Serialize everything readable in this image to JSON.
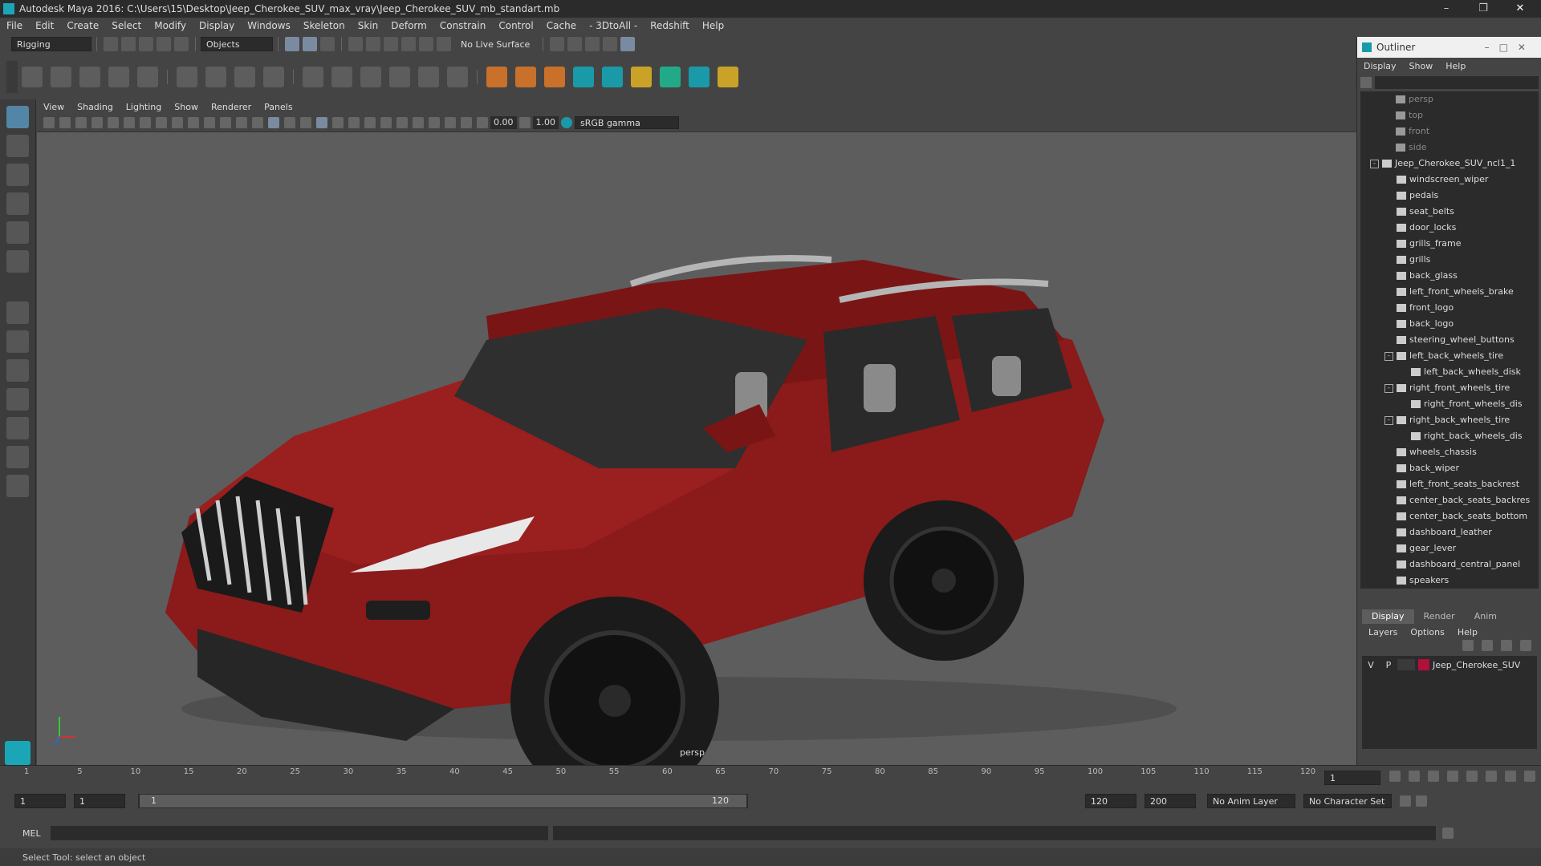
{
  "app": {
    "title": "Autodesk Maya 2016: C:\\Users\\15\\Desktop\\Jeep_Cherokee_SUV_max_vray\\Jeep_Cherokee_SUV_mb_standart.mb"
  },
  "menus": [
    "File",
    "Edit",
    "Create",
    "Select",
    "Modify",
    "Display",
    "Windows",
    "Skeleton",
    "Skin",
    "Deform",
    "Constrain",
    "Control",
    "Cache",
    "- 3DtoAll -",
    "Redshift",
    "Help"
  ],
  "statusline": {
    "menuset": "Rigging",
    "selmode": "Objects",
    "live_surface": "No Live Surface"
  },
  "viewport": {
    "menus": [
      "View",
      "Shading",
      "Lighting",
      "Show",
      "Renderer",
      "Panels"
    ],
    "exposure": "0.00",
    "gamma": "1.00",
    "colorspace": "sRGB gamma",
    "camera_label": "persp"
  },
  "outliner": {
    "title": "Outliner",
    "menus": [
      "Display",
      "Show",
      "Help"
    ],
    "items": [
      {
        "label": "persp",
        "kind": "cam",
        "depth": 0
      },
      {
        "label": "top",
        "kind": "cam",
        "depth": 0
      },
      {
        "label": "front",
        "kind": "cam",
        "depth": 0
      },
      {
        "label": "side",
        "kind": "cam",
        "depth": 0
      },
      {
        "label": "Jeep_Cherokee_SUV_ncl1_1",
        "kind": "grp",
        "depth": 0,
        "exp": "-"
      },
      {
        "label": "windscreen_wiper",
        "kind": "mesh",
        "depth": 1
      },
      {
        "label": "pedals",
        "kind": "mesh",
        "depth": 1
      },
      {
        "label": "seat_belts",
        "kind": "mesh",
        "depth": 1
      },
      {
        "label": "door_locks",
        "kind": "mesh",
        "depth": 1
      },
      {
        "label": "grills_frame",
        "kind": "mesh",
        "depth": 1
      },
      {
        "label": "grills",
        "kind": "mesh",
        "depth": 1
      },
      {
        "label": "back_glass",
        "kind": "mesh",
        "depth": 1
      },
      {
        "label": "left_front_wheels_brake",
        "kind": "mesh",
        "depth": 1
      },
      {
        "label": "front_logo",
        "kind": "mesh",
        "depth": 1
      },
      {
        "label": "back_logo",
        "kind": "mesh",
        "depth": 1
      },
      {
        "label": "steering_wheel_buttons",
        "kind": "mesh",
        "depth": 1
      },
      {
        "label": "left_back_wheels_tire",
        "kind": "mesh",
        "depth": 1,
        "exp": "-"
      },
      {
        "label": "left_back_wheels_disk",
        "kind": "mesh",
        "depth": 2
      },
      {
        "label": "right_front_wheels_tire",
        "kind": "mesh",
        "depth": 1,
        "exp": "-"
      },
      {
        "label": "right_front_wheels_dis",
        "kind": "mesh",
        "depth": 2
      },
      {
        "label": "right_back_wheels_tire",
        "kind": "mesh",
        "depth": 1,
        "exp": "-"
      },
      {
        "label": "right_back_wheels_dis",
        "kind": "mesh",
        "depth": 2
      },
      {
        "label": "wheels_chassis",
        "kind": "mesh",
        "depth": 1
      },
      {
        "label": "back_wiper",
        "kind": "mesh",
        "depth": 1
      },
      {
        "label": "left_front_seats_backrest",
        "kind": "mesh",
        "depth": 1
      },
      {
        "label": "center_back_seats_backres",
        "kind": "mesh",
        "depth": 1
      },
      {
        "label": "center_back_seats_bottom",
        "kind": "mesh",
        "depth": 1
      },
      {
        "label": "dashboard_leather",
        "kind": "mesh",
        "depth": 1
      },
      {
        "label": "gear_lever",
        "kind": "mesh",
        "depth": 1
      },
      {
        "label": "dashboard_central_panel",
        "kind": "mesh",
        "depth": 1
      },
      {
        "label": "speakers",
        "kind": "mesh",
        "depth": 1
      }
    ]
  },
  "layers": {
    "tabs": [
      "Display",
      "Render",
      "Anim"
    ],
    "menus": [
      "Layers",
      "Options",
      "Help"
    ],
    "layer": {
      "v": "V",
      "p": "P",
      "name": "Jeep_Cherokee_SUV",
      "color": "#b0103a"
    }
  },
  "timeline": {
    "ticks": [
      "1",
      "5",
      "10",
      "15",
      "20",
      "25",
      "30",
      "35",
      "40",
      "45",
      "50",
      "55",
      "60",
      "65",
      "70",
      "75",
      "80",
      "85",
      "90",
      "95",
      "100",
      "105",
      "110",
      "115",
      "120"
    ],
    "current": "1"
  },
  "range": {
    "start": "1",
    "inner_start": "1",
    "slider_start": "1",
    "slider_end": "120",
    "end": "120",
    "max": "200",
    "anim_layer": "No Anim Layer",
    "char_set": "No Character Set"
  },
  "cmd": {
    "label": "MEL"
  },
  "help": {
    "text": "Select Tool: select an object"
  },
  "colors": {
    "car_body": "#8b1a1a",
    "viewport_bg": "#5d5d5d",
    "accent": "#5285a6"
  }
}
